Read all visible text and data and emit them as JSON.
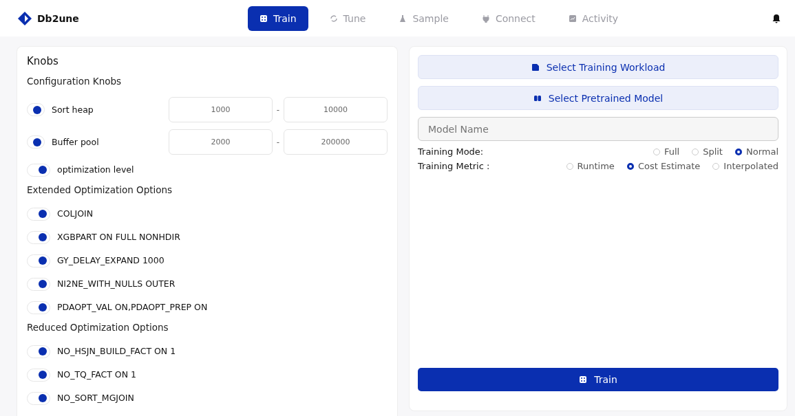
{
  "brand": {
    "name": "Db2une"
  },
  "nav": [
    {
      "label": "Train",
      "selected": true
    },
    {
      "label": "Tune",
      "selected": false
    },
    {
      "label": "Sample",
      "selected": false
    },
    {
      "label": "Connect",
      "selected": false
    },
    {
      "label": "Activity",
      "selected": false
    }
  ],
  "knobs": {
    "title": "Knobs",
    "sections": [
      {
        "heading": "Configuration Knobs",
        "items": [
          {
            "label": "Sort heap",
            "on": true,
            "range": [
              "1000",
              "10000"
            ],
            "separator": "-"
          },
          {
            "label": "Buffer pool",
            "on": true,
            "range": [
              "2000",
              "200000"
            ],
            "separator": "-"
          },
          {
            "label": "optimization level",
            "on": true
          }
        ]
      },
      {
        "heading": "Extended Optimization Options",
        "items": [
          {
            "label": "COLJOIN",
            "on": true
          },
          {
            "label": "XGBPART ON FULL NONHDIR",
            "on": true
          },
          {
            "label": "GY_DELAY_EXPAND 1000",
            "on": true
          },
          {
            "label": "NI2NE_WITH_NULLS OUTER",
            "on": true
          },
          {
            "label": "PDAOPT_VAL ON,PDAOPT_PREP ON",
            "on": true
          }
        ]
      },
      {
        "heading": "Reduced Optimization Options",
        "items": [
          {
            "label": "NO_HSJN_BUILD_FACT ON 1",
            "on": true
          },
          {
            "label": "NO_TQ_FACT ON 1",
            "on": true
          },
          {
            "label": "NO_SORT_MGJOIN",
            "on": true
          }
        ]
      }
    ]
  },
  "training": {
    "buttons": [
      {
        "label": "Select Training Workload"
      },
      {
        "label": "Select Pretrained Model"
      }
    ],
    "model_name": {
      "placeholder": "Model Name"
    },
    "options": [
      {
        "label": "Training Mode:",
        "choices": [
          {
            "label": "Full",
            "selected": false
          },
          {
            "label": "Split",
            "selected": false
          },
          {
            "label": "Normal",
            "selected": true
          }
        ]
      },
      {
        "label": "Training Metric :",
        "choices": [
          {
            "label": "Runtime",
            "selected": false
          },
          {
            "label": "Cost Estimate",
            "selected": true
          },
          {
            "label": "Interpolated",
            "selected": false
          }
        ]
      }
    ],
    "submit": {
      "label": "Train"
    }
  }
}
